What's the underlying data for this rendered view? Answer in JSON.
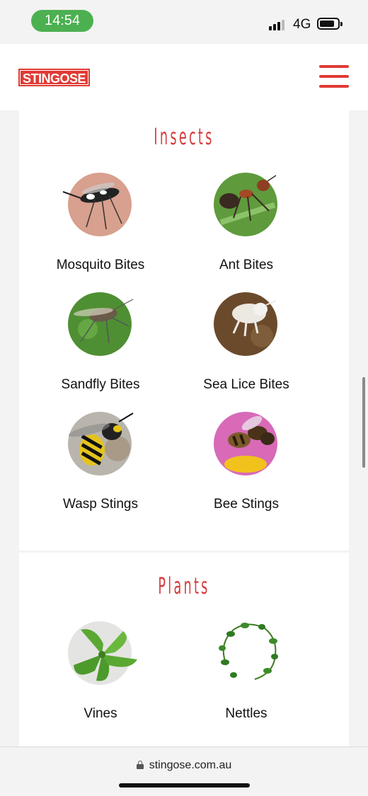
{
  "status_bar": {
    "time": "14:54",
    "network": "4G",
    "battery_level": 0.75
  },
  "header": {
    "logo_text": "STINGOSE",
    "menu_icon": "hamburger-icon"
  },
  "colors": {
    "brand_red": "#e03a34",
    "status_green": "#4cb050"
  },
  "insects": {
    "title": "Insects",
    "items": [
      {
        "label": "Mosquito Bites"
      },
      {
        "label": "Ant Bites"
      },
      {
        "label": "Sandfly Bites"
      },
      {
        "label": "Sea Lice Bites"
      },
      {
        "label": "Wasp Stings"
      },
      {
        "label": "Bee Stings"
      }
    ]
  },
  "plants": {
    "title": "Plants",
    "items": [
      {
        "label": "Vines"
      },
      {
        "label": "Nettles"
      }
    ]
  },
  "browser": {
    "url": "stingose.com.au"
  }
}
